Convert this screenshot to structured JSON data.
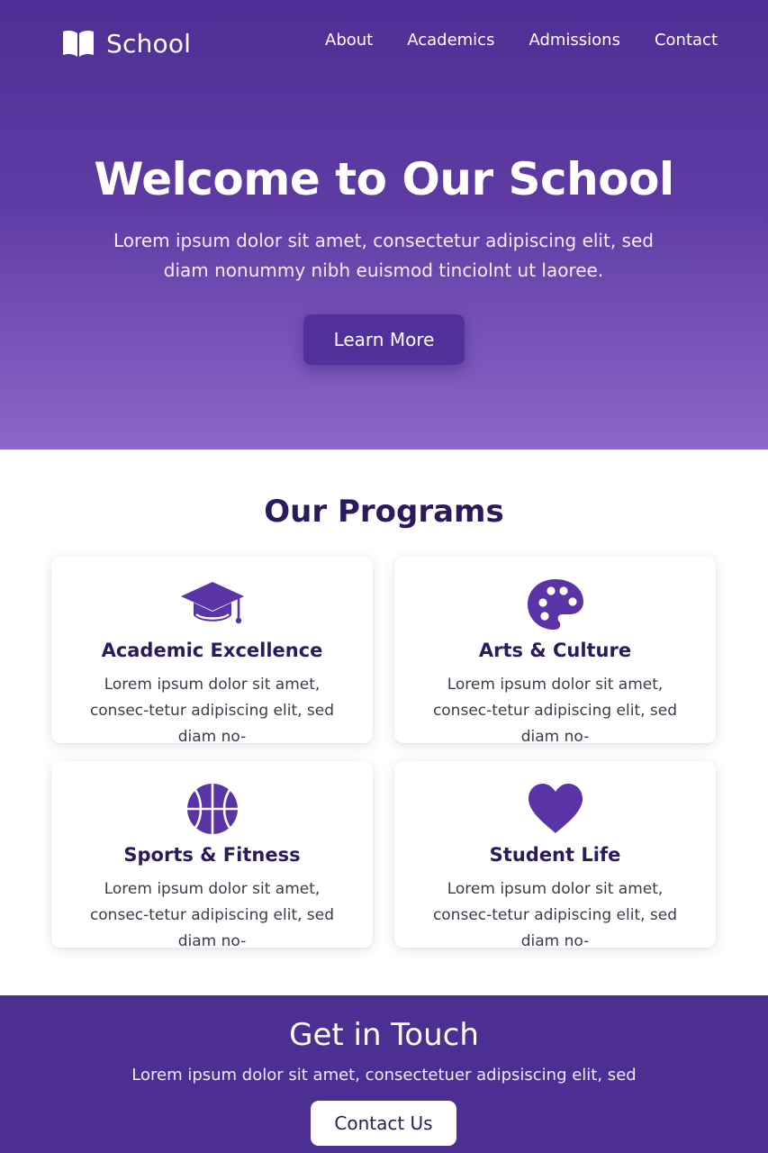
{
  "colors": {
    "brand_purple": "#4f2f95",
    "hero_gradient_end": "#8b67c8",
    "button_purple": "#51309a",
    "heading_dark": "#2b1b5e",
    "icon_purple": "#5a34a6",
    "white": "#ffffff"
  },
  "header": {
    "logo_icon": "open-book-icon",
    "brand": "School",
    "nav": [
      "About",
      "Academics",
      "Admissions",
      "Contact"
    ]
  },
  "hero": {
    "title": "Welcome to Our School",
    "subtitle": "Lorem ipsum dolor sit amet, consectetur adipiscing elit, sed diam nonummy nibh euismod tinciolnt ut laoree.",
    "button": "Learn More"
  },
  "programs": {
    "title": "Our Programs",
    "cards": [
      {
        "icon": "graduation-cap-icon",
        "title": "Academic Excellence",
        "desc": "Lorem ipsum dolor sit amet, consec-tetur adipiscing elit, sed diam no-"
      },
      {
        "icon": "palette-icon",
        "title": "Arts & Culture",
        "desc": "Lorem ipsum dolor sit amet, consec-tetur adipiscing elit, sed diam no-"
      },
      {
        "icon": "basketball-icon",
        "title": "Sports & Fitness",
        "desc": "Lorem ipsum dolor sit amet, consec-tetur adipiscing elit, sed diam no-"
      },
      {
        "icon": "heart-icon",
        "title": "Student Life",
        "desc": "Lorem ipsum dolor sit amet, consec-tetur adipiscing elit, sed diam no-"
      }
    ]
  },
  "contact": {
    "title": "Get in Touch",
    "subtitle": "Lorem ipsum dolor sit amet, consectetuer adipsiscing elit, sed",
    "button": "Contact Us"
  }
}
